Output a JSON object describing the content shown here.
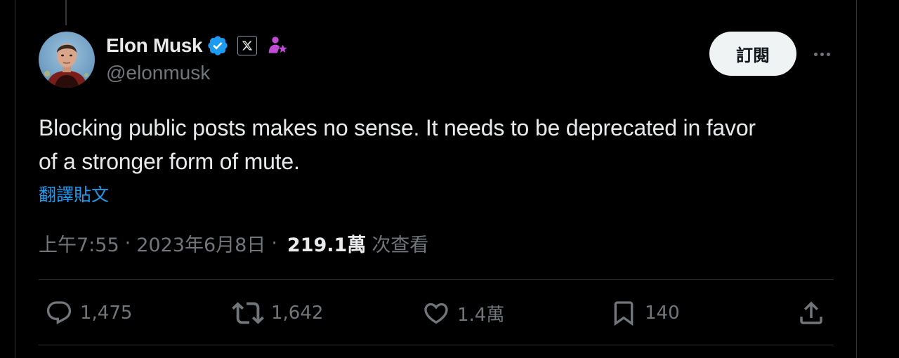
{
  "author": {
    "display_name": "Elon Musk",
    "handle": "@elonmusk",
    "verified_badge": "verified-badge-icon",
    "affiliate_icon": "x-logo-icon",
    "subscriber_icon": "person-star-icon"
  },
  "header": {
    "subscribe_label": "訂閱",
    "more_icon": "more-horizontal-icon"
  },
  "tweet": {
    "text_line1": "Blocking public posts makes no sense. It needs to be deprecated in favor",
    "text_line2": "of a stronger form of mute.",
    "translate_label": "翻譯貼文"
  },
  "meta": {
    "time": "上午7:55",
    "separator": "·",
    "date": "2023年6月8日",
    "views_count": "219.1萬",
    "views_label": "次查看"
  },
  "actions": {
    "reply_count": "1,475",
    "retweet_count": "1,642",
    "like_count": "1.4萬",
    "bookmark_count": "140"
  },
  "colors": {
    "background": "#000000",
    "primary_text": "#e7e9ea",
    "secondary_text": "#71767b",
    "link": "#1d9bf0",
    "verified": "#1d9bf0",
    "subscriber_icon": "#c04bd4",
    "button_bg": "#eff3f4"
  }
}
